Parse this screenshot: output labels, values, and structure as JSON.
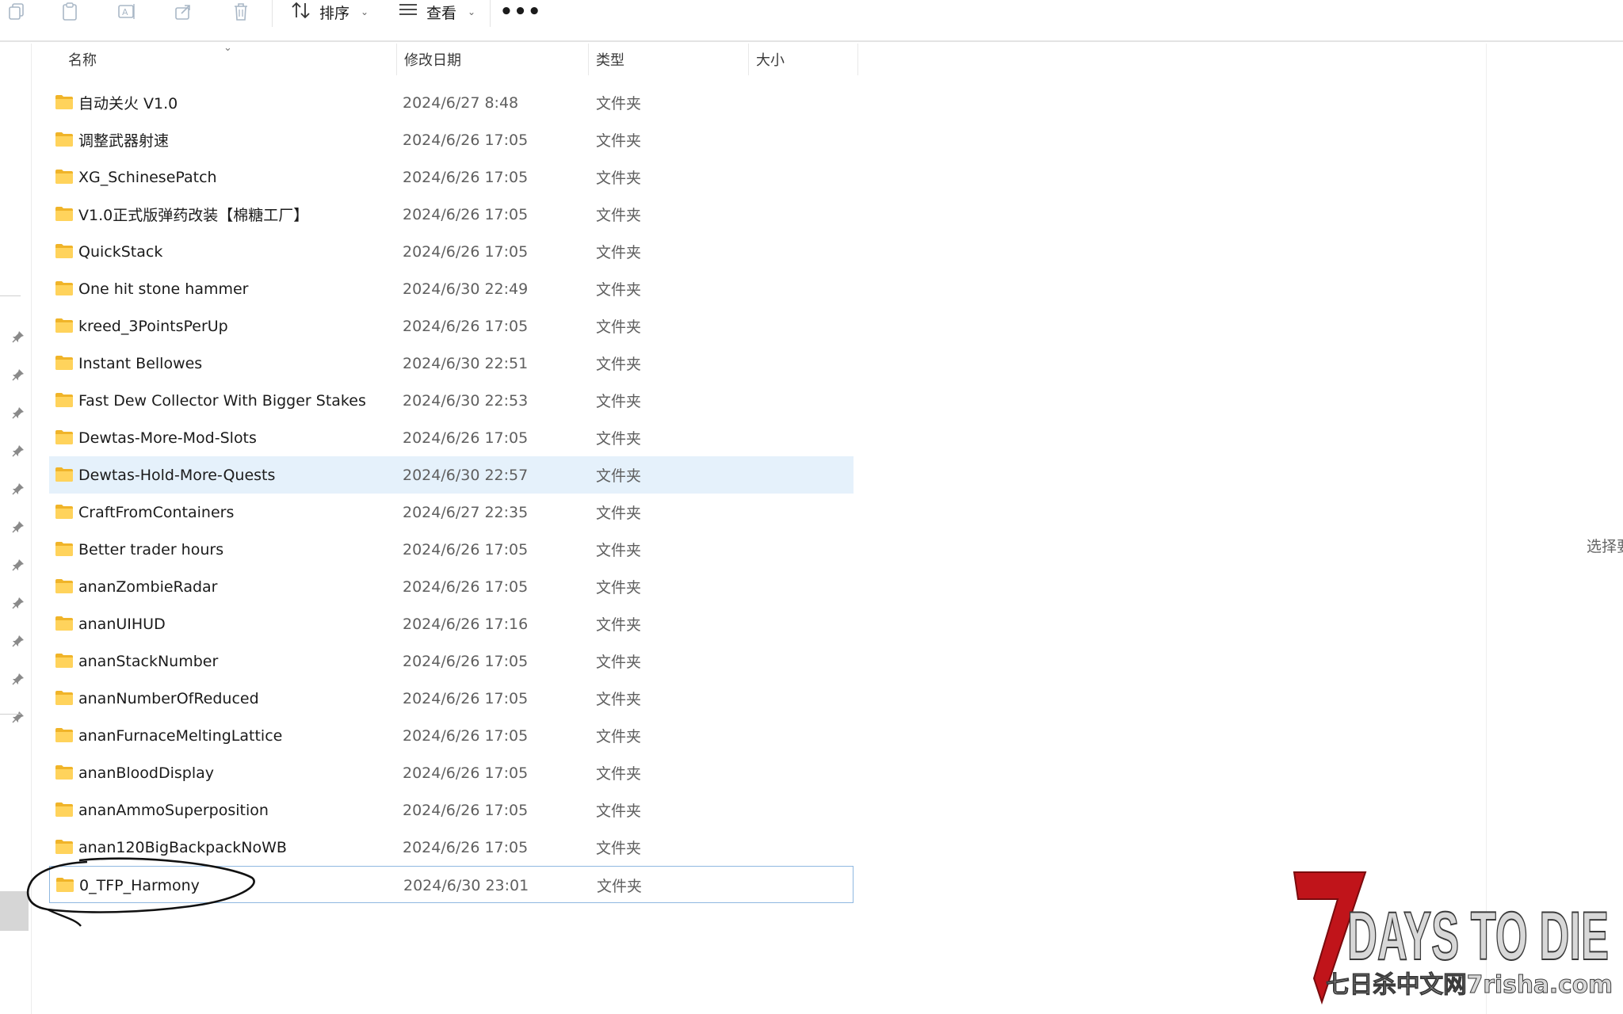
{
  "toolbar": {
    "sort_label": "排序",
    "view_label": "查看",
    "more_label": "•••",
    "icons": [
      "copy-icon",
      "paste-icon",
      "rename-icon",
      "share-icon",
      "delete-icon",
      "sort-icon",
      "view-icon",
      "more-icon"
    ]
  },
  "columns": {
    "name": "名称",
    "modified": "修改日期",
    "type": "类型",
    "size": "大小"
  },
  "files": [
    {
      "name": "自动关火 V1.0",
      "date": "2024/6/27 8:48",
      "type": "文件夹"
    },
    {
      "name": "调整武器射速",
      "date": "2024/6/26 17:05",
      "type": "文件夹"
    },
    {
      "name": "XG_SchinesePatch",
      "date": "2024/6/26 17:05",
      "type": "文件夹"
    },
    {
      "name": "V1.0正式版弹药改装【棉糖工厂】",
      "date": "2024/6/26 17:05",
      "type": "文件夹"
    },
    {
      "name": "QuickStack",
      "date": "2024/6/26 17:05",
      "type": "文件夹"
    },
    {
      "name": "One hit stone hammer",
      "date": "2024/6/30 22:49",
      "type": "文件夹"
    },
    {
      "name": "kreed_3PointsPerUp",
      "date": "2024/6/26 17:05",
      "type": "文件夹"
    },
    {
      "name": "Instant Bellowes",
      "date": "2024/6/30 22:51",
      "type": "文件夹"
    },
    {
      "name": "Fast Dew Collector With Bigger Stakes",
      "date": "2024/6/30 22:53",
      "type": "文件夹"
    },
    {
      "name": "Dewtas-More-Mod-Slots",
      "date": "2024/6/26 17:05",
      "type": "文件夹"
    },
    {
      "name": "Dewtas-Hold-More-Quests",
      "date": "2024/6/30 22:57",
      "type": "文件夹"
    },
    {
      "name": "CraftFromContainers",
      "date": "2024/6/27 22:35",
      "type": "文件夹"
    },
    {
      "name": "Better trader hours",
      "date": "2024/6/26 17:05",
      "type": "文件夹"
    },
    {
      "name": "ananZombieRadar",
      "date": "2024/6/26 17:05",
      "type": "文件夹"
    },
    {
      "name": "ananUIHUD",
      "date": "2024/6/26 17:16",
      "type": "文件夹"
    },
    {
      "name": "ananStackNumber",
      "date": "2024/6/26 17:05",
      "type": "文件夹"
    },
    {
      "name": "ananNumberOfReduced",
      "date": "2024/6/26 17:05",
      "type": "文件夹"
    },
    {
      "name": "ananFurnaceMeltingLattice",
      "date": "2024/6/26 17:05",
      "type": "文件夹"
    },
    {
      "name": "ananBloodDisplay",
      "date": "2024/6/26 17:05",
      "type": "文件夹"
    },
    {
      "name": "ananAmmoSuperposition",
      "date": "2024/6/26 17:05",
      "type": "文件夹"
    },
    {
      "name": "anan120BigBackpackNoWB",
      "date": "2024/6/26 17:05",
      "type": "文件夹"
    },
    {
      "name": "0_TFP_Harmony",
      "date": "2024/6/30 23:01",
      "type": "文件夹"
    }
  ],
  "preview_pane": {
    "hint": "选择要"
  },
  "watermark": {
    "logo_text": "7DAYS TO DIE",
    "site_text": "七日杀中文网7risha.com"
  },
  "colors": {
    "folder": "#ffc83d",
    "hover_row": "#e5f1fb",
    "selected_border": "#8fb8e0",
    "watermark_red": "#c0141a"
  }
}
